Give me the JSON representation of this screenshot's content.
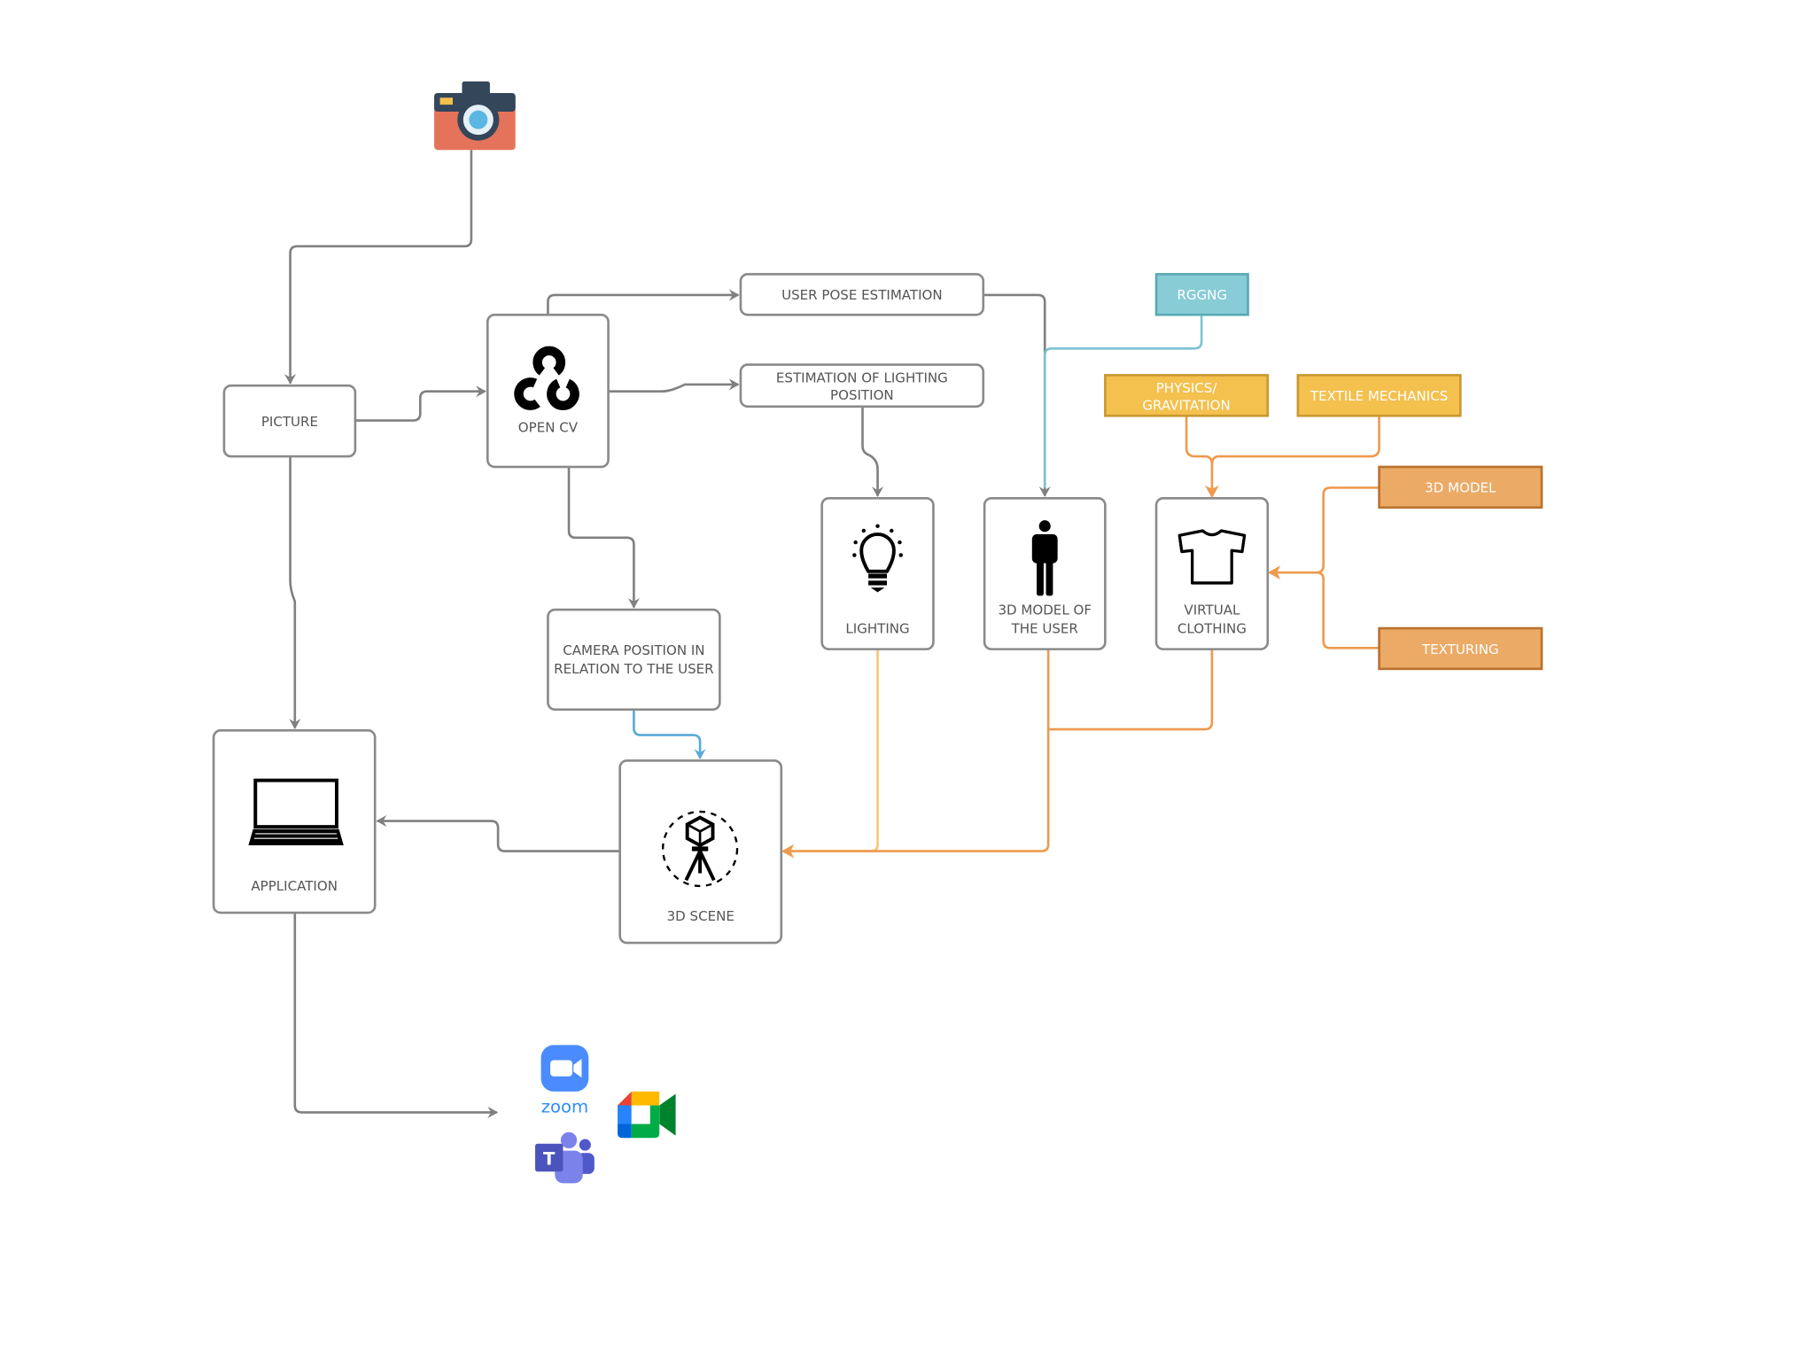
{
  "colors": {
    "gray_connector": "#808080",
    "teal": "#88CCD6",
    "teal_border": "#5AA9B5",
    "yellow": "#F4C04E",
    "yellow_border": "#C9982F",
    "orange": "#EBAA66",
    "orange_border": "#B8722E",
    "orange_line": "#EE9A4E",
    "light_yellow_line": "#F5C878",
    "blue_line": "#5AAAD8"
  },
  "nodes": {
    "picture": "PICTURE",
    "open_cv": "OPEN CV",
    "user_pose": "USER POSE ESTIMATION",
    "lighting_est_1": "ESTIMATION OF LIGHTING",
    "lighting_est_2": "POSITION",
    "rggng": "RGGNG",
    "physics_1": "PHYSICS/",
    "physics_2": "GRAVITATION",
    "textile": "TEXTILE MECHANICS",
    "model3d": "3D MODEL",
    "texturing": "TEXTURING",
    "lighting": "LIGHTING",
    "user_model_1": "3D MODEL OF",
    "user_model_2": "THE USER",
    "clothing_1": "VIRTUAL",
    "clothing_2": "CLOTHING",
    "camera_pos_1": "CAMERA POSITION IN",
    "camera_pos_2": "RELATION TO THE USER",
    "application": "APPLICATION",
    "scene": "3D SCENE",
    "zoom_logo": "zoom"
  },
  "icons": [
    "camera-icon",
    "opencv-icon",
    "lightbulb-icon",
    "person-icon",
    "tshirt-icon",
    "laptop-icon",
    "3d-scene-tripod-icon",
    "zoom-icon",
    "google-meet-icon",
    "ms-teams-icon"
  ]
}
